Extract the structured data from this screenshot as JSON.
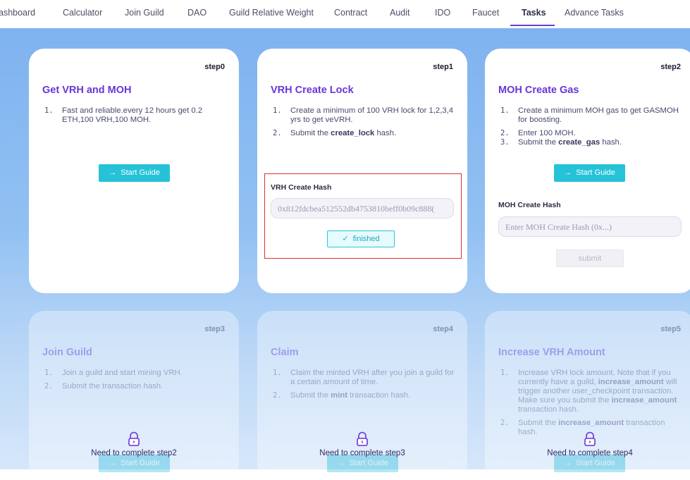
{
  "nav": {
    "items": [
      "ashboard",
      "Calculator",
      "Join Guild",
      "DAO",
      "Guild Relative Weight",
      "Contract",
      "Audit",
      "IDO",
      "Faucet",
      "Tasks",
      "Advance Tasks"
    ]
  },
  "cards": [
    {
      "step": "step0",
      "title": "Get VRH and MOH",
      "items": [
        "Fast and reliable.every 12 hours get 0.2 ETH,100 VRH,100 MOH."
      ],
      "button": "Start Guide"
    },
    {
      "step": "step1",
      "title": "VRH Create Lock",
      "items": [
        "Create a minimum of 100 VRH lock for 1,2,3,4 yrs to get veVRH."
      ],
      "item2_pre": "Submit the ",
      "item2_bold": "create_lock",
      "item2_post": " hash.",
      "hash_label": "VRH Create Hash",
      "hash_value": "0x812fdcbea512552db4753810beff0b09c888(",
      "finished": "finished"
    },
    {
      "step": "step2",
      "title": "MOH Create Gas",
      "items": [
        "Create a minimum MOH gas to get GASMOH for boosting.",
        "Enter 100 MOH."
      ],
      "item3_pre": "Submit the ",
      "item3_bold": "create_gas",
      "item3_post": " hash.",
      "button": "Start Guide",
      "hash_label": "MOH Create Hash",
      "hash_placeholder": "Enter MOH Create Hash (0x...)",
      "submit": "submit"
    },
    {
      "step": "step3",
      "title": "Join Guild",
      "items": [
        "Join a guild and start mining VRH.",
        "Submit the transaction hash."
      ],
      "button": "Start Guide",
      "lock": "Need to complete step2"
    },
    {
      "step": "step4",
      "title": "Claim",
      "items": [
        "Claim the minted VRH after you join a guild for a certain amount of time."
      ],
      "item2_pre": "Submit the ",
      "item2_bold": "mint",
      "item2_post": " transaction hash.",
      "button": "Start Guide",
      "lock": "Need to complete step3"
    },
    {
      "step": "step5",
      "title": "Increase VRH Amount",
      "item1_a": "Increase VRH lock amount. Note that if you currently have a guild, ",
      "item1_b": "increase_amount",
      "item1_c": " will trigger another user_checkpoint transaction. Make sure you submit the ",
      "item1_d": "increase_amount",
      "item1_e": " transaction hash.",
      "item2_pre": "Submit the ",
      "item2_bold": "increase_amount",
      "item2_post": " transaction hash.",
      "button": "Start Guide",
      "lock": "Need to complete step4"
    }
  ],
  "list_numbers": [
    "1.",
    "2.",
    "3."
  ],
  "colors": {
    "accent": "#6a35d6",
    "button": "#26c2d8",
    "highlight": "#e03030"
  }
}
